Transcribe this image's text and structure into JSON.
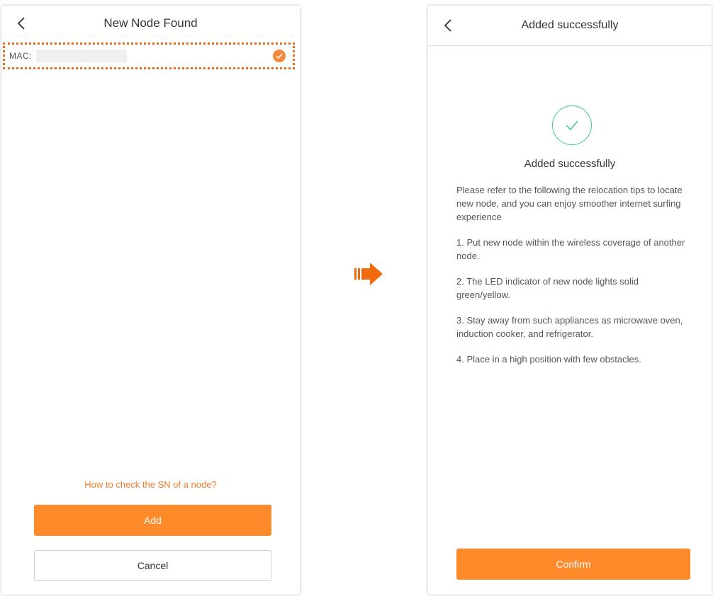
{
  "left_screen": {
    "title": "New Node Found",
    "mac_label": "MAC:",
    "help_link": "How to check the SN of a node?",
    "add_label": "Add",
    "cancel_label": "Cancel"
  },
  "right_screen": {
    "title": "Added successfully",
    "heading": "Added successfully",
    "intro": "Please refer to the following the relocation tips to locate new node, and you can enjoy smoother internet surfing experience",
    "tips": [
      "1. Put new node within the wireless coverage of another node.",
      "2. The LED indicator of new node lights solid green/yellow.",
      "3. Stay away from such appliances as microwave oven, induction cooker, and refrigerator.",
      "4. Place in a high position with few obstacles."
    ],
    "confirm_label": "Confirm"
  },
  "icons": {
    "back": "chevron-left-icon",
    "check": "check-icon",
    "success": "success-check-icon",
    "arrow": "arrow-right-icon"
  },
  "colors": {
    "accent": "#ff8a2a",
    "link": "#f37b2a",
    "highlight_border": "#e86a1c",
    "success": "#3fc4a0"
  }
}
